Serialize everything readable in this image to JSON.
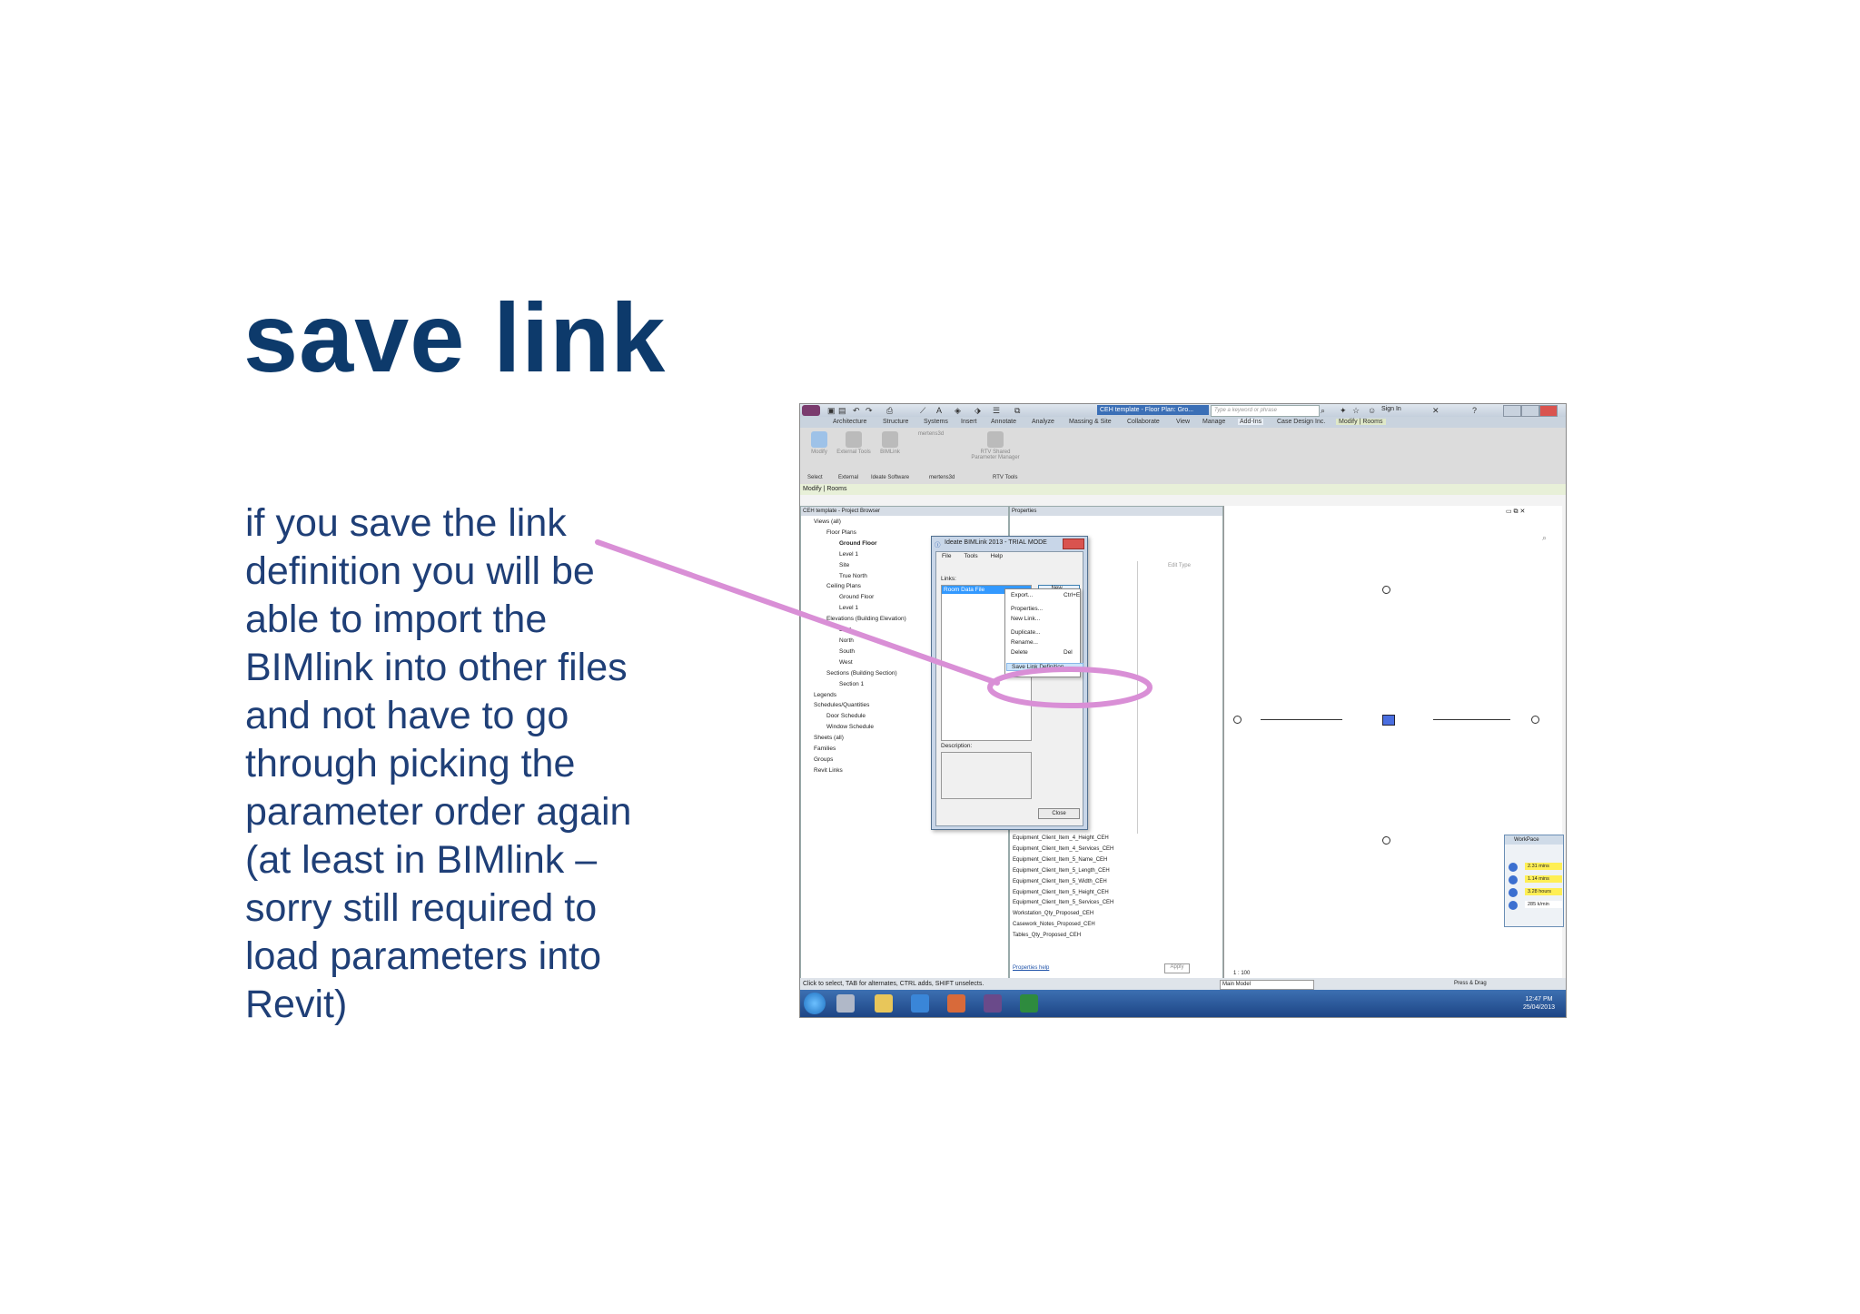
{
  "slide": {
    "title": "save link",
    "body_lines": [
      "if you save the link",
      "definition you will be",
      "able to import the",
      "BIMlink into other files",
      "and not have to go",
      "through picking the",
      "parameter order again",
      "(at least in BIMlink –",
      "sorry still required to",
      "load parameters into",
      "Revit)"
    ]
  },
  "annotation": {
    "color": "#d98fd6"
  },
  "revit": {
    "window_title": "CEH template - Floor Plan: Gro...",
    "search_placeholder": "Type a keyword or phrase",
    "sign_in": "Sign In",
    "tabs": [
      "Architecture",
      "Structure",
      "Systems",
      "Insert",
      "Annotate",
      "Analyze",
      "Massing & Site",
      "Collaborate",
      "View",
      "Manage",
      "Add-Ins",
      "Case Design Inc.",
      "Modify | Rooms"
    ],
    "ribbon_buttons": [
      "Modify",
      "External Tools",
      "BIMLink",
      "mertens3d",
      "RTV Shared Parameter Manager"
    ],
    "ribbon_panels": [
      "Select",
      "External",
      "Ideate Software",
      "mertens3d",
      "RTV Tools"
    ],
    "context_bar": "Modify | Rooms",
    "project_browser": {
      "header": "CEH template - Project Browser",
      "tree": [
        {
          "label": "Views (all)",
          "indent": 1
        },
        {
          "label": "Floor Plans",
          "indent": 2
        },
        {
          "label": "Ground Floor",
          "indent": 3,
          "bold": true
        },
        {
          "label": "Level 1",
          "indent": 3
        },
        {
          "label": "Site",
          "indent": 3
        },
        {
          "label": "True North",
          "indent": 3
        },
        {
          "label": "Ceiling Plans",
          "indent": 2
        },
        {
          "label": "Ground Floor",
          "indent": 3
        },
        {
          "label": "Level 1",
          "indent": 3
        },
        {
          "label": "Elevations (Building Elevation)",
          "indent": 2
        },
        {
          "label": "East",
          "indent": 3
        },
        {
          "label": "North",
          "indent": 3
        },
        {
          "label": "South",
          "indent": 3
        },
        {
          "label": "West",
          "indent": 3
        },
        {
          "label": "Sections (Building Section)",
          "indent": 2
        },
        {
          "label": "Section 1",
          "indent": 3
        },
        {
          "label": "Legends",
          "indent": 1
        },
        {
          "label": "Schedules/Quantities",
          "indent": 1
        },
        {
          "label": "Door Schedule",
          "indent": 2
        },
        {
          "label": "Window Schedule",
          "indent": 2
        },
        {
          "label": "Sheets (all)",
          "indent": 1
        },
        {
          "label": "Families",
          "indent": 1
        },
        {
          "label": "Groups",
          "indent": 1
        },
        {
          "label": "Revit Links",
          "indent": 1
        }
      ]
    },
    "properties": {
      "header": "Properties",
      "edit_type": "Edit Type",
      "rows": [
        "Equipment_Client_Item_4_Height_CEH",
        "Equipment_Client_Item_4_Services_CEH",
        "Equipment_Client_Item_5_Name_CEH",
        "Equipment_Client_Item_5_Length_CEH",
        "Equipment_Client_Item_5_Width_CEH",
        "Equipment_Client_Item_5_Height_CEH",
        "Equipment_Client_Item_5_Services_CEH",
        "Workstation_Qty_Proposed_CEH",
        "Casework_Notes_Proposed_CEH",
        "Tables_Qty_Proposed_CEH"
      ],
      "help_link": "Properties help",
      "apply": "Apply"
    },
    "dialog": {
      "title": "Ideate BIMLink 2013 - TRIAL MODE",
      "menu": [
        "File",
        "Tools",
        "Help"
      ],
      "links_label": "Links:",
      "selected_link": "Room Data File",
      "new_button": "New...",
      "description_label": "Description:",
      "close_button": "Close"
    },
    "context_menu": [
      {
        "label": "Export...",
        "shortcut": "Ctrl+E"
      },
      {
        "label": "Properties...",
        "shortcut": ""
      },
      {
        "label": "New Link...",
        "shortcut": ""
      },
      {
        "label": "Duplicate...",
        "shortcut": ""
      },
      {
        "label": "Rename...",
        "shortcut": ""
      },
      {
        "label": "Delete",
        "shortcut": "Del"
      },
      {
        "label": "Save Link Definition...",
        "shortcut": "",
        "highlighted": true
      }
    ],
    "workpace": {
      "title": "WorkPace",
      "rows": [
        "2.31 mins",
        "1.14 mins",
        "3.28 hours",
        "285 k/min"
      ]
    },
    "status": {
      "hint": "Click to select, TAB for alternates, CTRL adds, SHIFT unselects.",
      "scale": "1 : 100",
      "model": "Main Model",
      "press_drag": "Press & Drag"
    },
    "clock": {
      "time": "12:47 PM",
      "date": "25/04/2013"
    }
  }
}
